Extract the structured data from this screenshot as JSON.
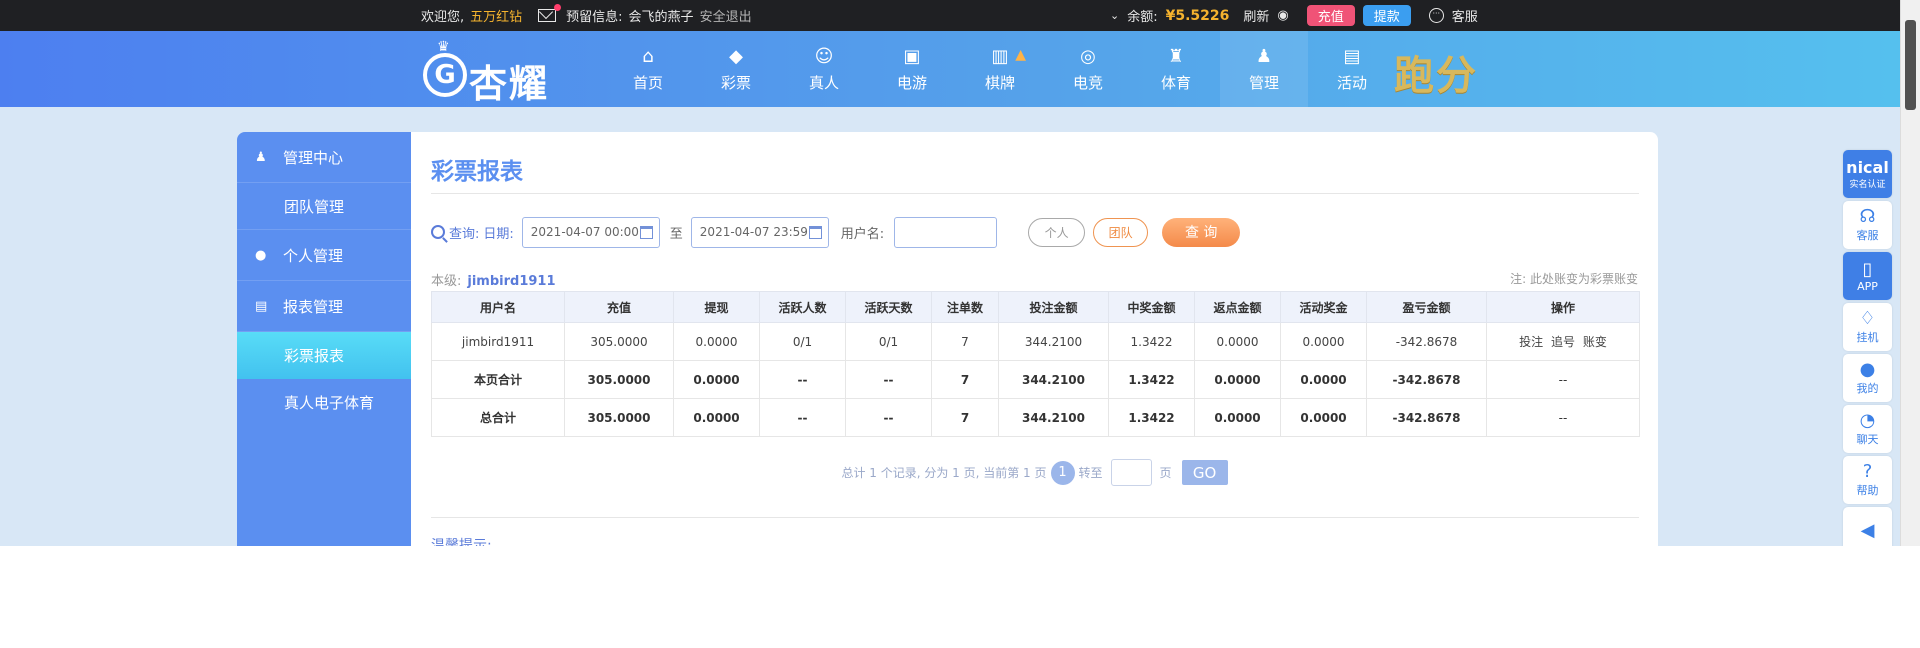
{
  "topbar": {
    "welcome": "欢迎您,",
    "user_nick": "五万红钻",
    "reserve_label": "预留信息:",
    "reserve_value": "会飞的燕子",
    "logout": "安全退出",
    "chevron": "⌄",
    "balance_label": "余额:",
    "balance_value": "¥5.5226",
    "refresh": "刷新",
    "recharge": "充值",
    "withdraw": "提款",
    "service": "客服"
  },
  "header": {
    "logo_text": "杏耀",
    "logo_letter": "G",
    "nav": [
      {
        "label": "首页",
        "icon": "⌂"
      },
      {
        "label": "彩票",
        "icon": "◆"
      },
      {
        "label": "真人",
        "icon": "☺"
      },
      {
        "label": "电游",
        "icon": "▣"
      },
      {
        "label": "棋牌",
        "icon": "▥"
      },
      {
        "label": "电竞",
        "icon": "◎"
      },
      {
        "label": "体育",
        "icon": "♜"
      },
      {
        "label": "管理",
        "icon": "♟"
      },
      {
        "label": "活动",
        "icon": "▤"
      }
    ],
    "flame": "▲",
    "paofen": "跑分"
  },
  "sidebar": {
    "manage_center": "管理中心",
    "team_manage": "团队管理",
    "personal_manage": "个人管理",
    "report_manage": "报表管理",
    "lottery_report": "彩票报表",
    "live_egame_sports": "真人电子体育"
  },
  "main": {
    "title": "彩票报表",
    "query_label": "查询:",
    "date_label": "日期:",
    "date_start": "2021-04-07 00:00",
    "date_end": "2021-04-07 23:59",
    "to": "至",
    "username_label": "用户名:",
    "personal_btn": "个人",
    "team_btn": "团队",
    "query_btn": "查 询",
    "level_label": "本级:",
    "level_user": "jimbird1911",
    "note": "注: 此处账变为彩票账变",
    "table": {
      "headers": [
        "用户名",
        "充值",
        "提现",
        "活跃人数",
        "活跃天数",
        "注单数",
        "投注金额",
        "中奖金额",
        "返点金额",
        "活动奖金",
        "盈亏金额",
        "操作"
      ],
      "rows": [
        [
          "jimbird1911",
          "305.0000",
          "0.0000",
          "0/1",
          "0/1",
          "7",
          "344.2100",
          "1.3422",
          "0.0000",
          "0.0000",
          "-342.8678"
        ],
        [
          "本页合计",
          "305.0000",
          "0.0000",
          "--",
          "--",
          "7",
          "344.2100",
          "1.3422",
          "0.0000",
          "0.0000",
          "-342.8678",
          "--"
        ],
        [
          "总合计",
          "305.0000",
          "0.0000",
          "--",
          "--",
          "7",
          "344.2100",
          "1.3422",
          "0.0000",
          "0.0000",
          "-342.8678",
          "--"
        ]
      ],
      "ops": [
        "投注",
        "追号",
        "账变"
      ]
    },
    "pager": {
      "summary": "总计 1 个记录, 分为 1 页, 当前第 1 页",
      "current": "1",
      "goto": "转至",
      "page_unit": "页",
      "go": "GO"
    },
    "tips": "温馨提示:"
  },
  "right_toolbar": {
    "nical": "nical",
    "nical_sub": "实名认证",
    "service": "客服",
    "app": "APP",
    "hangup": "挂机",
    "mine": "我的",
    "chat": "聊天",
    "help": "帮助"
  }
}
